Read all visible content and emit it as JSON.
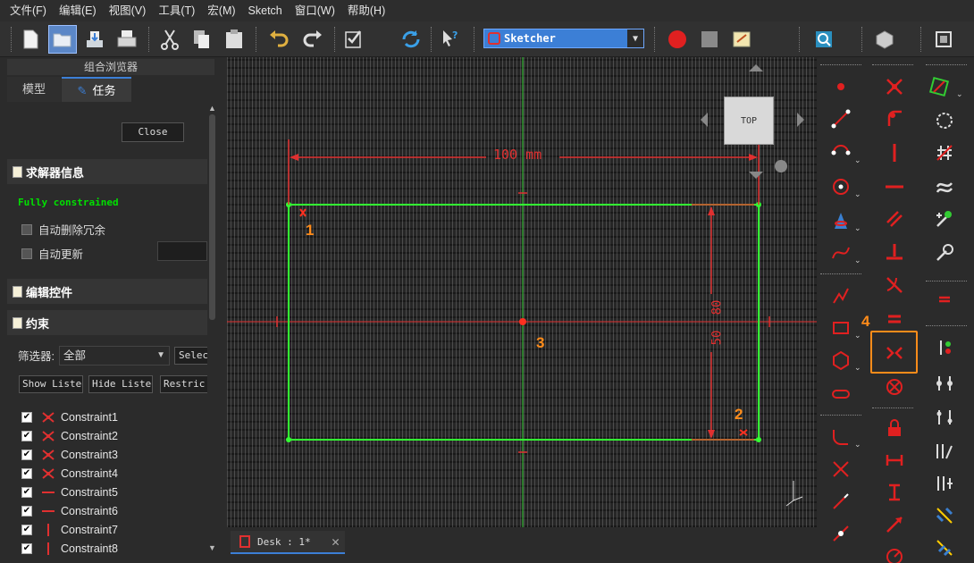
{
  "menubar": {
    "items": [
      "文件(F)",
      "编辑(E)",
      "视图(V)",
      "工具(T)",
      "宏(M)",
      "Sketch",
      "窗口(W)",
      "帮助(H)"
    ]
  },
  "toolbar": {
    "workbench": "Sketcher",
    "icons": [
      "new-file-icon",
      "open-folder-icon",
      "save-icon",
      "print-icon",
      "cut-icon",
      "copy-icon",
      "paste-icon",
      "undo-icon",
      "redo-icon",
      "checklist-icon",
      "refresh-icon",
      "whats-this-icon",
      "record-macro-icon",
      "stop-macro-icon",
      "edit-macro-icon",
      "zoom-icon",
      "part-icon",
      "view-box-icon"
    ]
  },
  "left_panel": {
    "title": "组合浏览器",
    "tabs": {
      "model": "模型",
      "task": "任务"
    },
    "close_label": "Close",
    "solver": {
      "header": "求解器信息",
      "status": "Fully constrained",
      "auto_remove_redundant": "自动删除冗余",
      "auto_update": "自动更新"
    },
    "edit_controls_header": "编辑控件",
    "constraints": {
      "header": "约束",
      "filter_label": "筛选器:",
      "filter_value": "全部",
      "select_label": "Selec",
      "show_listed": "Show Listed",
      "hide_listed": "Hide Listed",
      "restrict": "Restric",
      "items": [
        {
          "name": "Constraint1",
          "icon": "coincident-icon",
          "checked": true
        },
        {
          "name": "Constraint2",
          "icon": "coincident-icon",
          "checked": true
        },
        {
          "name": "Constraint3",
          "icon": "coincident-icon",
          "checked": true
        },
        {
          "name": "Constraint4",
          "icon": "coincident-icon",
          "checked": true
        },
        {
          "name": "Constraint5",
          "icon": "horizontal-icon",
          "checked": true
        },
        {
          "name": "Constraint6",
          "icon": "horizontal-icon",
          "checked": true
        },
        {
          "name": "Constraint7",
          "icon": "vertical-icon",
          "checked": true
        },
        {
          "name": "Constraint8",
          "icon": "vertical-icon",
          "checked": true
        }
      ]
    }
  },
  "canvas": {
    "dim_horizontal": "100 mm",
    "dim_vertical_1": "80",
    "dim_vertical_2": "50",
    "markers": [
      "1",
      "2",
      "3",
      "4"
    ],
    "navcube_face": "TOP",
    "colors": {
      "geometry": "#33ff33",
      "constraint": "#ff2a2a",
      "marker": "#ff8c1a"
    }
  },
  "bottom_tab": {
    "label": "Desk : 1*"
  },
  "right_toolbar": {
    "col1": [
      "point-icon",
      "line-icon",
      "arc-icon",
      "circle-icon",
      "conic-icon",
      "bspline-icon",
      "polyline-icon",
      "rectangle-icon",
      "polygon-icon",
      "slot-icon",
      "fillet-icon",
      "trim-icon",
      "extend-icon",
      "split-icon"
    ],
    "col2": [
      "coincident-icon",
      "point-on-object-icon",
      "vertical-icon",
      "horizontal-icon",
      "parallel-icon",
      "perpendicular-icon",
      "tangent-icon",
      "equal-icon",
      "symmetric-icon",
      "block-icon",
      "lock-icon",
      "horizontal-distance-icon",
      "vertical-distance-icon",
      "distance-icon",
      "radius-icon"
    ],
    "col3": [
      "validate-icon",
      "close-shape-icon",
      "connect-icon",
      "select-constraints-icon",
      "select-origin-icon",
      "select-conflict-icon",
      "restore-icon",
      "copy-icon",
      "move-icon",
      "rectangular-array-icon",
      "remove-axes-icon",
      "delete-all-icon"
    ]
  }
}
